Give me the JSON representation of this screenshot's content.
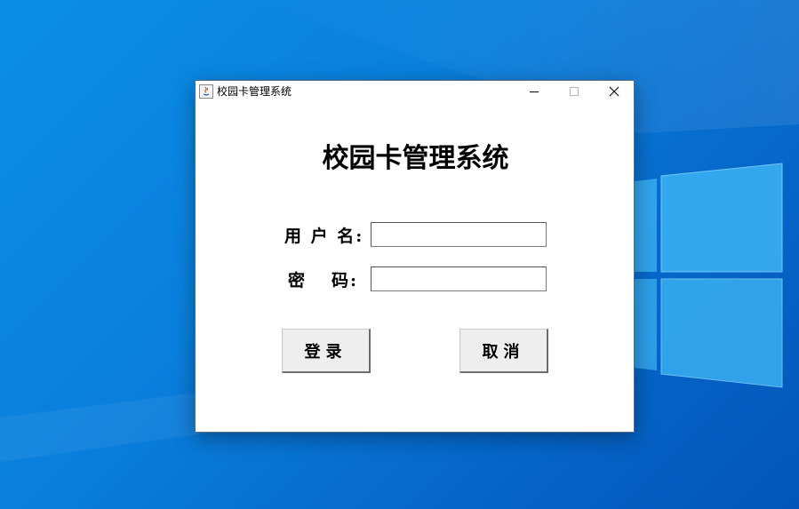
{
  "desktop": {
    "background_color": "#0a7fdc"
  },
  "window": {
    "title": "校园卡管理系统",
    "icon": "java-app-icon",
    "controls": {
      "minimize": "minimize-icon",
      "maximize": "maximize-icon",
      "close": "close-icon"
    }
  },
  "login": {
    "heading": "校园卡管理系统",
    "username_label_part1": "用 户 名",
    "username_label_colon": ":",
    "password_label_part1": "密",
    "password_label_part2": "码",
    "password_label_colon": ":",
    "username_value": "",
    "password_value": "",
    "login_button": "登录",
    "cancel_button": "取消"
  }
}
